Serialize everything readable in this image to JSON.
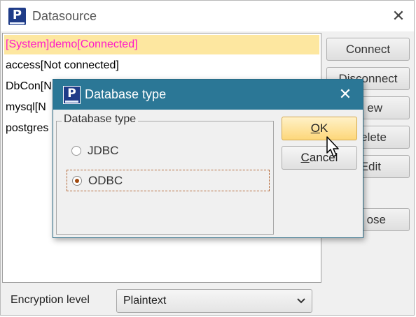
{
  "window": {
    "title": "Datasource",
    "icon": "app-p-icon",
    "close": "✕"
  },
  "datasources": [
    "[System]demo[Connected]",
    "access[Not connected]",
    "DbCon[N",
    "mysql[N",
    "postgres"
  ],
  "buttons": {
    "connect": "Connect",
    "disconnect": "Disconnect",
    "new": "ew",
    "delete": "elete",
    "edit": "Edit",
    "close": "ose"
  },
  "encryption": {
    "label": "Encryption level",
    "value": "Plaintext"
  },
  "dialog": {
    "title": "Database type",
    "close": "✕",
    "group_title": "Database type",
    "options": [
      {
        "label": "JDBC",
        "selected": false
      },
      {
        "label": "ODBC",
        "selected": true
      }
    ],
    "ok": {
      "mnemonic": "O",
      "rest": "K"
    },
    "cancel": {
      "mnemonic": "C",
      "rest": "ancel"
    }
  },
  "colors": {
    "dialog_title_bg": "#2b7796",
    "selected_row_bg": "#fde7a0",
    "selected_row_text": "#ff19c8"
  }
}
